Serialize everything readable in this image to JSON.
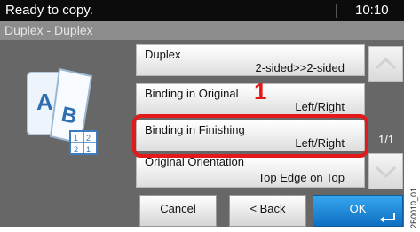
{
  "status": {
    "message": "Ready to copy.",
    "time": "10:10"
  },
  "title": "Duplex - Duplex",
  "options": [
    {
      "label": "Duplex",
      "value": "2-sided>>2-sided"
    },
    {
      "label": "Binding in Original",
      "value": "Left/Right"
    },
    {
      "label": "Binding in Finishing",
      "value": "Left/Right"
    },
    {
      "label": "Original Orientation",
      "value": "Top Edge on Top"
    }
  ],
  "annotation": {
    "step": "1",
    "color": "#e41a1a"
  },
  "pagination": {
    "indicator": "1/1"
  },
  "buttons": {
    "cancel": "Cancel",
    "back": "< Back",
    "ok": "OK"
  },
  "figure_code": "2B0010_01",
  "colors": {
    "ok_button": "#1a86d6",
    "panel": "#676767",
    "status_bar": "#0c0c0c"
  }
}
